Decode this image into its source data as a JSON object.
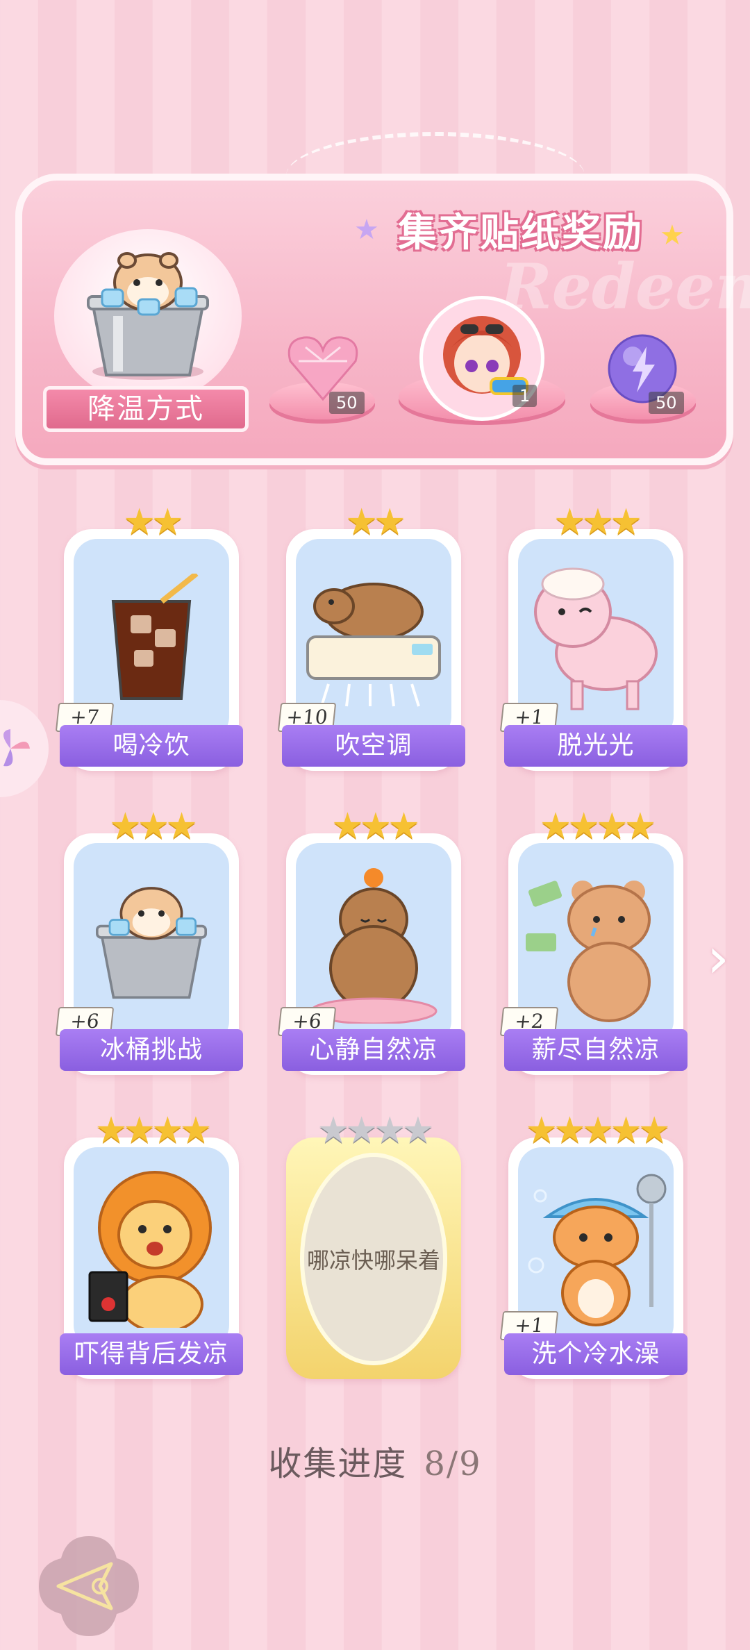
{
  "banner": {
    "title": "集齐贴纸奖励",
    "watermark": "Redeem",
    "method_label": "降温方式",
    "rewards": [
      {
        "name": "pink-heart-gem-icon",
        "count": "50"
      },
      {
        "name": "girl-avatar-icon",
        "count": "1"
      },
      {
        "name": "lightning-orb-icon",
        "count": "50"
      }
    ]
  },
  "cards": [
    {
      "label": "喝冷饮",
      "bonus": "+7",
      "stars": "★★",
      "icon": "iced-drink-icon"
    },
    {
      "label": "吹空调",
      "bonus": "+10",
      "stars": "★★",
      "icon": "capybara-air-conditioner-icon"
    },
    {
      "label": "脱光光",
      "bonus": "+1",
      "stars": "★★★",
      "icon": "sheep-icon"
    },
    {
      "label": "冰桶挑战",
      "bonus": "+6",
      "stars": "★★★",
      "icon": "hamster-ice-bucket-icon"
    },
    {
      "label": "心静自然凉",
      "bonus": "+6",
      "stars": "★★★",
      "icon": "meditating-capybara-icon"
    },
    {
      "label": "薪尽自然凉",
      "bonus": "+2",
      "stars": "★★★★",
      "icon": "crying-bear-money-icon"
    },
    {
      "label": "吓得背后发凉",
      "bonus": "",
      "stars": "★★★★",
      "icon": "scared-lion-icon"
    },
    {
      "label": "哪凉快哪呆着",
      "bonus": "",
      "stars": "★★★★",
      "icon": "locked-sticker",
      "locked": true
    },
    {
      "label": "洗个冷水澡",
      "bonus": "+1",
      "stars": "★★★★★",
      "icon": "cat-shower-icon"
    }
  ],
  "progress": {
    "label": "收集进度",
    "value": "8/9"
  },
  "colors": {
    "label_purple": "#8a5fe0",
    "banner_pink": "#f7b6c8",
    "star_gold": "#f6c133"
  }
}
